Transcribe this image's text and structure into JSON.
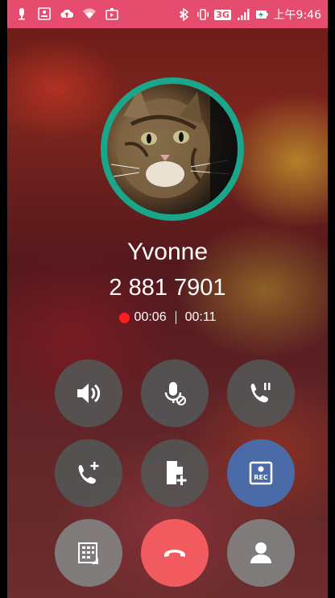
{
  "status_bar": {
    "time": "上午9:46",
    "network": "3G",
    "left_icons": [
      "mic-icon",
      "rec-icon",
      "cloud-upload-icon",
      "wifi-icon",
      "media-icon"
    ],
    "right_icons": [
      "bluetooth-icon",
      "vibrate-icon",
      "3g-icon",
      "signal-icon",
      "battery-charging-icon"
    ],
    "color": "#e64c6e"
  },
  "contact": {
    "name": "Yvonne",
    "number": "2 881 7901"
  },
  "timers": {
    "recording": "00:06",
    "call": "00:11"
  },
  "controls": [
    {
      "id": "speaker",
      "icon": "speaker-icon"
    },
    {
      "id": "mute",
      "icon": "mic-mute-icon"
    },
    {
      "id": "hold",
      "icon": "call-hold-icon"
    },
    {
      "id": "add-call",
      "icon": "add-call-icon"
    },
    {
      "id": "add-contact-file",
      "icon": "add-file-icon"
    },
    {
      "id": "record",
      "icon": "rec-icon",
      "label": "REC"
    },
    {
      "id": "keypad",
      "icon": "keypad-icon"
    },
    {
      "id": "end-call",
      "icon": "end-call-icon"
    },
    {
      "id": "contact",
      "icon": "person-icon"
    }
  ],
  "colors": {
    "avatar_ring": "#1aa68a",
    "record_button": "#4a6aa8",
    "end_call": "#f15a5e",
    "rec_dot": "#ff1e1e"
  }
}
